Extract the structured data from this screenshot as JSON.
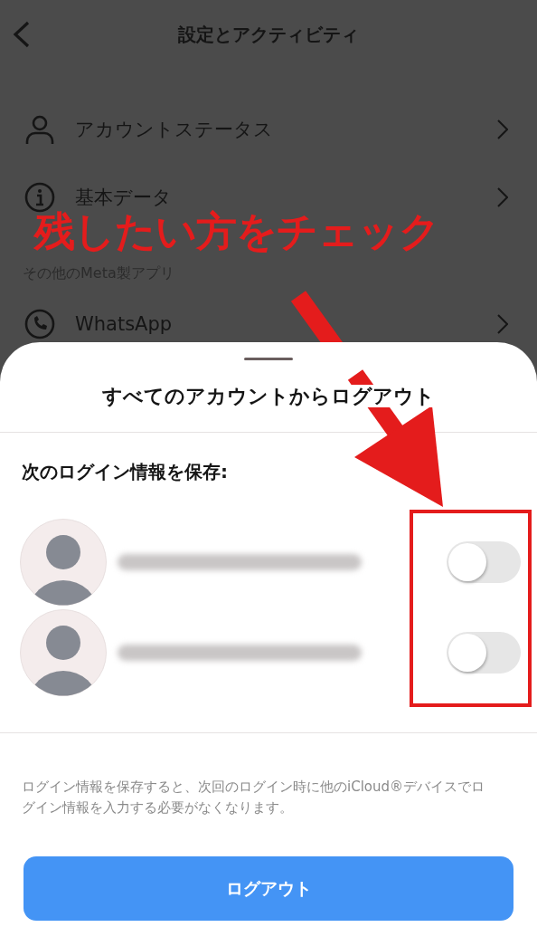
{
  "header": {
    "title": "設定とアクティビティ"
  },
  "settings": {
    "items": [
      {
        "kind": "person",
        "label": "アカウントステータス"
      },
      {
        "kind": "info",
        "label": "基本データ"
      }
    ],
    "section": "その他のMeta製アプリ",
    "apps": [
      {
        "kind": "phone",
        "label": "WhatsApp"
      }
    ]
  },
  "sheet": {
    "title": "すべてのアカウントからログアウト",
    "subtitle": "次のログイン情報を保存:",
    "accounts": [
      {
        "on": false
      },
      {
        "on": false
      }
    ],
    "note": "ログイン情報を保存すると、次回のログイン時に他のiCloud®デバイスでログイン情報を入力する必要がなくなります。",
    "button": "ログアウト"
  },
  "annotation": {
    "text": "残したい方をチェック"
  }
}
